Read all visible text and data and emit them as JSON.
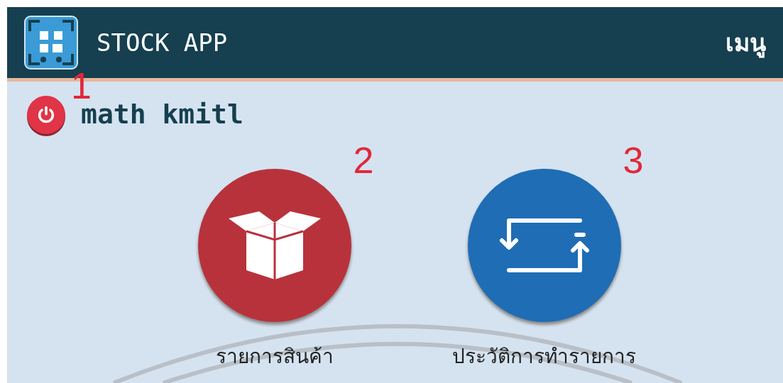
{
  "header": {
    "title": "STOCK APP",
    "menu": "เมนู"
  },
  "user": {
    "name": "math kmitl"
  },
  "actions": [
    {
      "kind": "products",
      "label": "รายการสินค้า",
      "color": "#b8323c"
    },
    {
      "kind": "history",
      "label": "ประวัติการทำรายการ",
      "color": "#1f6db5"
    }
  ],
  "annotations": [
    "1",
    "2",
    "3"
  ]
}
